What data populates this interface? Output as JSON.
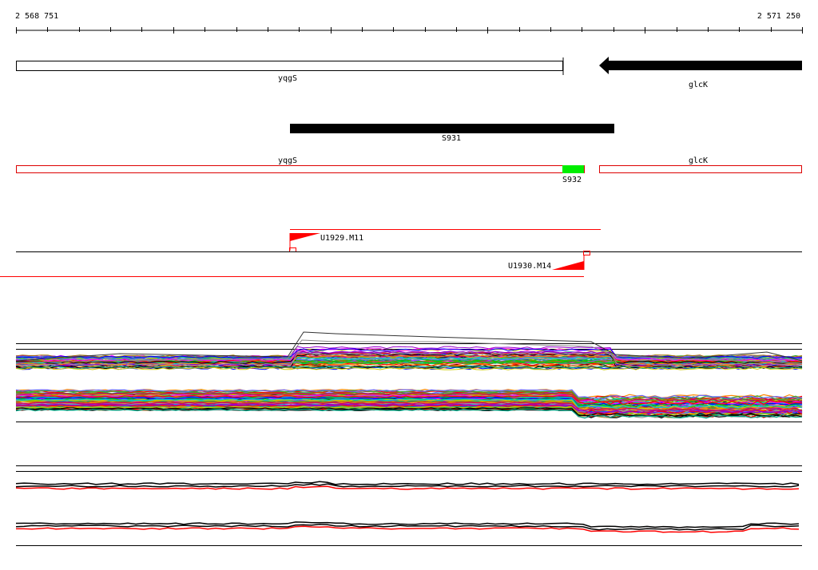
{
  "ruler": {
    "start_label": "2 568 751",
    "end_label": "2 571 250"
  },
  "genes": [
    {
      "name": "yqgS",
      "strand": "+",
      "color": "#ffffff"
    },
    {
      "name": "glcK",
      "strand": "-",
      "color": "#000000"
    }
  ],
  "segment_track": {
    "label": "S931",
    "color": "#000000"
  },
  "annotation_track": {
    "labels": [
      "yqgS",
      "S932",
      "glcK"
    ],
    "outline_color": "#dd0000",
    "highlight_color": "#00ee00"
  },
  "promoters": [
    {
      "label": "U1929.M11",
      "color": "#ff0000"
    },
    {
      "label": "U1930.M14",
      "color": "#ff0000"
    }
  ],
  "colors": {
    "accent_red": "#ff0000",
    "gene_black": "#000000",
    "highlight_green": "#00ee00"
  }
}
